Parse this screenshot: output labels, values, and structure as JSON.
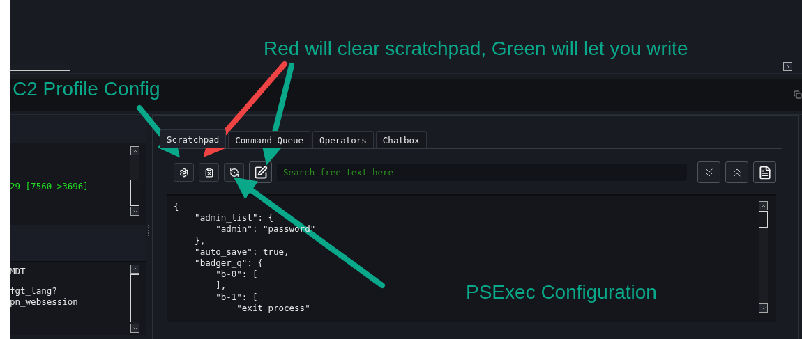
{
  "log_panels": [
    {
      "paragraphs": [
        [
          {
            "text": "29 [7560->3696]",
            "color": "#22dd22"
          }
        ]
      ]
    },
    {
      "paragraphs": [
        [
          {
            "text": "MDT",
            "color": "#e6e6e6"
          }
        ],
        [
          {
            "text": "fgt_lang?",
            "color": "#e6e6e6"
          },
          {
            "text": "pn_websession",
            "color": "#e6e6e6"
          }
        ]
      ]
    }
  ],
  "tabs": [
    {
      "label": "Scratchpad",
      "selected": true
    },
    {
      "label": "Command Queue",
      "selected": false
    },
    {
      "label": "Operators",
      "selected": false
    },
    {
      "label": "Chatbox",
      "selected": false
    }
  ],
  "toolbar_left": [
    {
      "kind": "settings"
    },
    {
      "kind": "clear"
    },
    {
      "kind": "psexec"
    },
    {
      "kind": "write"
    }
  ],
  "search": {
    "placeholder": "Search free text here"
  },
  "toolbar_right": [
    {
      "kind": "down"
    },
    {
      "kind": "up"
    },
    {
      "kind": "export"
    }
  ],
  "editor_lines": [
    "{",
    "    \"admin_list\": {",
    "        \"admin\": \"password\"",
    "    },",
    "    \"auto_save\": true,",
    "    \"badger_q\": {",
    "        \"b-0\": [",
    "        ],",
    "        \"b-1\": [",
    "            \"exit_process\""
  ],
  "annotations": [
    {
      "text": "Red will clear scratchpad, Green will let you write"
    },
    {
      "text": "C2 Profile Config"
    },
    {
      "text": "PSExec Configuration"
    }
  ],
  "arrows": [
    {
      "color": "#0aa88a"
    },
    {
      "color": "#f04444"
    },
    {
      "color": "#0aa88a"
    },
    {
      "color": "#0aa88a"
    }
  ]
}
